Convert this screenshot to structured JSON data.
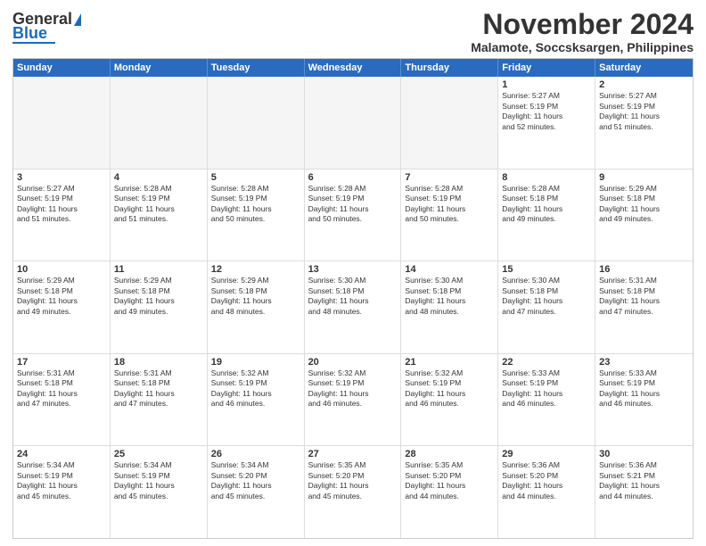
{
  "logo": {
    "line1": "General",
    "line2": "Blue"
  },
  "header": {
    "month": "November 2024",
    "location": "Malamote, Soccsksargen, Philippines"
  },
  "days_of_week": [
    "Sunday",
    "Monday",
    "Tuesday",
    "Wednesday",
    "Thursday",
    "Friday",
    "Saturday"
  ],
  "weeks": [
    [
      {
        "num": "",
        "empty": true
      },
      {
        "num": "",
        "empty": true
      },
      {
        "num": "",
        "empty": true
      },
      {
        "num": "",
        "empty": true
      },
      {
        "num": "",
        "empty": true
      },
      {
        "num": "1",
        "detail": "Sunrise: 5:27 AM\nSunset: 5:19 PM\nDaylight: 11 hours\nand 52 minutes."
      },
      {
        "num": "2",
        "detail": "Sunrise: 5:27 AM\nSunset: 5:19 PM\nDaylight: 11 hours\nand 51 minutes."
      }
    ],
    [
      {
        "num": "3",
        "detail": "Sunrise: 5:27 AM\nSunset: 5:19 PM\nDaylight: 11 hours\nand 51 minutes."
      },
      {
        "num": "4",
        "detail": "Sunrise: 5:28 AM\nSunset: 5:19 PM\nDaylight: 11 hours\nand 51 minutes."
      },
      {
        "num": "5",
        "detail": "Sunrise: 5:28 AM\nSunset: 5:19 PM\nDaylight: 11 hours\nand 50 minutes."
      },
      {
        "num": "6",
        "detail": "Sunrise: 5:28 AM\nSunset: 5:19 PM\nDaylight: 11 hours\nand 50 minutes."
      },
      {
        "num": "7",
        "detail": "Sunrise: 5:28 AM\nSunset: 5:19 PM\nDaylight: 11 hours\nand 50 minutes."
      },
      {
        "num": "8",
        "detail": "Sunrise: 5:28 AM\nSunset: 5:18 PM\nDaylight: 11 hours\nand 49 minutes."
      },
      {
        "num": "9",
        "detail": "Sunrise: 5:29 AM\nSunset: 5:18 PM\nDaylight: 11 hours\nand 49 minutes."
      }
    ],
    [
      {
        "num": "10",
        "detail": "Sunrise: 5:29 AM\nSunset: 5:18 PM\nDaylight: 11 hours\nand 49 minutes."
      },
      {
        "num": "11",
        "detail": "Sunrise: 5:29 AM\nSunset: 5:18 PM\nDaylight: 11 hours\nand 49 minutes."
      },
      {
        "num": "12",
        "detail": "Sunrise: 5:29 AM\nSunset: 5:18 PM\nDaylight: 11 hours\nand 48 minutes."
      },
      {
        "num": "13",
        "detail": "Sunrise: 5:30 AM\nSunset: 5:18 PM\nDaylight: 11 hours\nand 48 minutes."
      },
      {
        "num": "14",
        "detail": "Sunrise: 5:30 AM\nSunset: 5:18 PM\nDaylight: 11 hours\nand 48 minutes."
      },
      {
        "num": "15",
        "detail": "Sunrise: 5:30 AM\nSunset: 5:18 PM\nDaylight: 11 hours\nand 47 minutes."
      },
      {
        "num": "16",
        "detail": "Sunrise: 5:31 AM\nSunset: 5:18 PM\nDaylight: 11 hours\nand 47 minutes."
      }
    ],
    [
      {
        "num": "17",
        "detail": "Sunrise: 5:31 AM\nSunset: 5:18 PM\nDaylight: 11 hours\nand 47 minutes."
      },
      {
        "num": "18",
        "detail": "Sunrise: 5:31 AM\nSunset: 5:18 PM\nDaylight: 11 hours\nand 47 minutes."
      },
      {
        "num": "19",
        "detail": "Sunrise: 5:32 AM\nSunset: 5:19 PM\nDaylight: 11 hours\nand 46 minutes."
      },
      {
        "num": "20",
        "detail": "Sunrise: 5:32 AM\nSunset: 5:19 PM\nDaylight: 11 hours\nand 46 minutes."
      },
      {
        "num": "21",
        "detail": "Sunrise: 5:32 AM\nSunset: 5:19 PM\nDaylight: 11 hours\nand 46 minutes."
      },
      {
        "num": "22",
        "detail": "Sunrise: 5:33 AM\nSunset: 5:19 PM\nDaylight: 11 hours\nand 46 minutes."
      },
      {
        "num": "23",
        "detail": "Sunrise: 5:33 AM\nSunset: 5:19 PM\nDaylight: 11 hours\nand 46 minutes."
      }
    ],
    [
      {
        "num": "24",
        "detail": "Sunrise: 5:34 AM\nSunset: 5:19 PM\nDaylight: 11 hours\nand 45 minutes."
      },
      {
        "num": "25",
        "detail": "Sunrise: 5:34 AM\nSunset: 5:19 PM\nDaylight: 11 hours\nand 45 minutes."
      },
      {
        "num": "26",
        "detail": "Sunrise: 5:34 AM\nSunset: 5:20 PM\nDaylight: 11 hours\nand 45 minutes."
      },
      {
        "num": "27",
        "detail": "Sunrise: 5:35 AM\nSunset: 5:20 PM\nDaylight: 11 hours\nand 45 minutes."
      },
      {
        "num": "28",
        "detail": "Sunrise: 5:35 AM\nSunset: 5:20 PM\nDaylight: 11 hours\nand 44 minutes."
      },
      {
        "num": "29",
        "detail": "Sunrise: 5:36 AM\nSunset: 5:20 PM\nDaylight: 11 hours\nand 44 minutes."
      },
      {
        "num": "30",
        "detail": "Sunrise: 5:36 AM\nSunset: 5:21 PM\nDaylight: 11 hours\nand 44 minutes."
      }
    ]
  ]
}
